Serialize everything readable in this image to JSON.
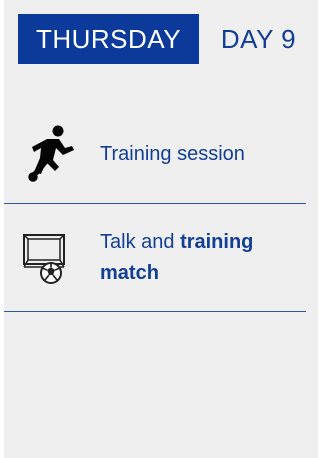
{
  "header": {
    "day_name": "THURSDAY",
    "day_number": "DAY 9"
  },
  "items": [
    {
      "icon": "kicking-player-icon",
      "title": "Training session"
    },
    {
      "icon": "soccer-goal-icon",
      "title_prefix": "Talk and ",
      "title_bold_1": "training",
      "title_bold_2": "match"
    }
  ],
  "colors": {
    "background": "#efefef",
    "primary_blue": "#0b3a9a",
    "text_blue": "#123f95",
    "divider_blue": "#2c5aa0"
  }
}
